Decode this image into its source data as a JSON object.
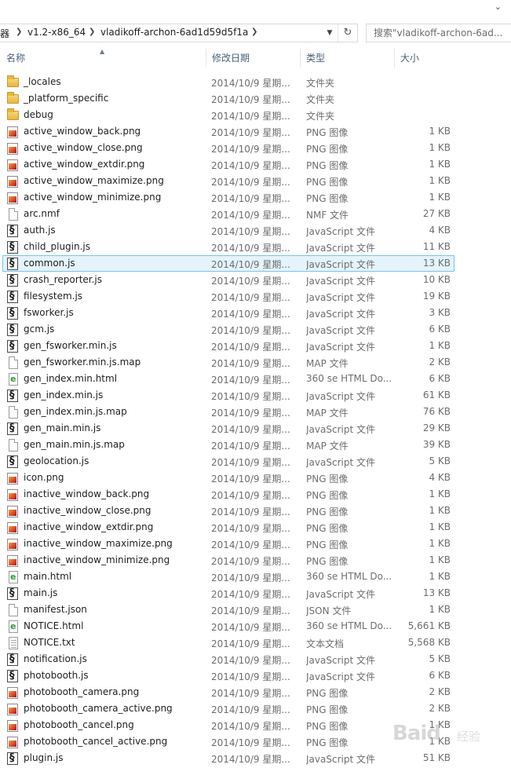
{
  "address_bar": {
    "crumbs": [
      "器",
      "v1.2-x86_64",
      "vladikoff-archon-6ad1d59d5f1a"
    ]
  },
  "search": {
    "placeholder": "搜索\"vladikoff-archon-6ad..."
  },
  "columns": {
    "name": "名称",
    "date": "修改日期",
    "type": "类型",
    "size": "大小"
  },
  "files": [
    {
      "name": "_locales",
      "date": "2014/10/9 星期...",
      "type": "文件夹",
      "size": "",
      "icon": "folder-icon"
    },
    {
      "name": "_platform_specific",
      "date": "2014/10/9 星期...",
      "type": "文件夹",
      "size": "",
      "icon": "folder-icon"
    },
    {
      "name": "debug",
      "date": "2014/10/9 星期...",
      "type": "文件夹",
      "size": "",
      "icon": "folder-icon"
    },
    {
      "name": "active_window_back.png",
      "date": "2014/10/9 星期...",
      "type": "PNG 图像",
      "size": "1 KB",
      "icon": "png-image-icon"
    },
    {
      "name": "active_window_close.png",
      "date": "2014/10/9 星期...",
      "type": "PNG 图像",
      "size": "1 KB",
      "icon": "png-image-icon"
    },
    {
      "name": "active_window_extdir.png",
      "date": "2014/10/9 星期...",
      "type": "PNG 图像",
      "size": "1 KB",
      "icon": "png-image-icon"
    },
    {
      "name": "active_window_maximize.png",
      "date": "2014/10/9 星期...",
      "type": "PNG 图像",
      "size": "1 KB",
      "icon": "png-image-icon"
    },
    {
      "name": "active_window_minimize.png",
      "date": "2014/10/9 星期...",
      "type": "PNG 图像",
      "size": "1 KB",
      "icon": "png-image-icon"
    },
    {
      "name": "arc.nmf",
      "date": "2014/10/9 星期...",
      "type": "NMF 文件",
      "size": "27 KB",
      "icon": "generic-file-icon"
    },
    {
      "name": "auth.js",
      "date": "2014/10/9 星期...",
      "type": "JavaScript 文件",
      "size": "4 KB",
      "icon": "javascript-file-icon"
    },
    {
      "name": "child_plugin.js",
      "date": "2014/10/9 星期...",
      "type": "JavaScript 文件",
      "size": "11 KB",
      "icon": "javascript-file-icon"
    },
    {
      "name": "common.js",
      "date": "2014/10/9 星期...",
      "type": "JavaScript 文件",
      "size": "13 KB",
      "icon": "javascript-file-icon",
      "selected": true
    },
    {
      "name": "crash_reporter.js",
      "date": "2014/10/9 星期...",
      "type": "JavaScript 文件",
      "size": "10 KB",
      "icon": "javascript-file-icon"
    },
    {
      "name": "filesystem.js",
      "date": "2014/10/9 星期...",
      "type": "JavaScript 文件",
      "size": "19 KB",
      "icon": "javascript-file-icon"
    },
    {
      "name": "fsworker.js",
      "date": "2014/10/9 星期...",
      "type": "JavaScript 文件",
      "size": "3 KB",
      "icon": "javascript-file-icon"
    },
    {
      "name": "gcm.js",
      "date": "2014/10/9 星期...",
      "type": "JavaScript 文件",
      "size": "6 KB",
      "icon": "javascript-file-icon"
    },
    {
      "name": "gen_fsworker.min.js",
      "date": "2014/10/9 星期...",
      "type": "JavaScript 文件",
      "size": "1 KB",
      "icon": "javascript-file-icon"
    },
    {
      "name": "gen_fsworker.min.js.map",
      "date": "2014/10/9 星期...",
      "type": "MAP 文件",
      "size": "2 KB",
      "icon": "generic-file-icon"
    },
    {
      "name": "gen_index.min.html",
      "date": "2014/10/9 星期...",
      "type": "360 se HTML Do...",
      "size": "6 KB",
      "icon": "html-file-icon"
    },
    {
      "name": "gen_index.min.js",
      "date": "2014/10/9 星期...",
      "type": "JavaScript 文件",
      "size": "61 KB",
      "icon": "javascript-file-icon"
    },
    {
      "name": "gen_index.min.js.map",
      "date": "2014/10/9 星期...",
      "type": "MAP 文件",
      "size": "76 KB",
      "icon": "generic-file-icon"
    },
    {
      "name": "gen_main.min.js",
      "date": "2014/10/9 星期...",
      "type": "JavaScript 文件",
      "size": "29 KB",
      "icon": "javascript-file-icon"
    },
    {
      "name": "gen_main.min.js.map",
      "date": "2014/10/9 星期...",
      "type": "MAP 文件",
      "size": "39 KB",
      "icon": "generic-file-icon"
    },
    {
      "name": "geolocation.js",
      "date": "2014/10/9 星期...",
      "type": "JavaScript 文件",
      "size": "5 KB",
      "icon": "javascript-file-icon"
    },
    {
      "name": "icon.png",
      "date": "2014/10/9 星期...",
      "type": "PNG 图像",
      "size": "4 KB",
      "icon": "png-image-icon"
    },
    {
      "name": "inactive_window_back.png",
      "date": "2014/10/9 星期...",
      "type": "PNG 图像",
      "size": "1 KB",
      "icon": "png-image-icon"
    },
    {
      "name": "inactive_window_close.png",
      "date": "2014/10/9 星期...",
      "type": "PNG 图像",
      "size": "1 KB",
      "icon": "png-image-icon"
    },
    {
      "name": "inactive_window_extdir.png",
      "date": "2014/10/9 星期...",
      "type": "PNG 图像",
      "size": "1 KB",
      "icon": "png-image-icon"
    },
    {
      "name": "inactive_window_maximize.png",
      "date": "2014/10/9 星期...",
      "type": "PNG 图像",
      "size": "1 KB",
      "icon": "png-image-icon"
    },
    {
      "name": "inactive_window_minimize.png",
      "date": "2014/10/9 星期...",
      "type": "PNG 图像",
      "size": "1 KB",
      "icon": "png-image-icon"
    },
    {
      "name": "main.html",
      "date": "2014/10/9 星期...",
      "type": "360 se HTML Do...",
      "size": "1 KB",
      "icon": "html-file-icon"
    },
    {
      "name": "main.js",
      "date": "2014/10/9 星期...",
      "type": "JavaScript 文件",
      "size": "13 KB",
      "icon": "javascript-file-icon"
    },
    {
      "name": "manifest.json",
      "date": "2014/10/9 星期...",
      "type": "JSON 文件",
      "size": "1 KB",
      "icon": "generic-file-icon"
    },
    {
      "name": "NOTICE.html",
      "date": "2014/10/9 星期...",
      "type": "360 se HTML Do...",
      "size": "5,661 KB",
      "icon": "html-file-icon"
    },
    {
      "name": "NOTICE.txt",
      "date": "2014/10/9 星期...",
      "type": "文本文档",
      "size": "5,568 KB",
      "icon": "text-file-icon"
    },
    {
      "name": "notification.js",
      "date": "2014/10/9 星期...",
      "type": "JavaScript 文件",
      "size": "5 KB",
      "icon": "javascript-file-icon"
    },
    {
      "name": "photobooth.js",
      "date": "2014/10/9 星期...",
      "type": "JavaScript 文件",
      "size": "6 KB",
      "icon": "javascript-file-icon"
    },
    {
      "name": "photobooth_camera.png",
      "date": "2014/10/9 星期...",
      "type": "PNG 图像",
      "size": "2 KB",
      "icon": "png-image-icon"
    },
    {
      "name": "photobooth_camera_active.png",
      "date": "2014/10/9 星期...",
      "type": "PNG 图像",
      "size": "2 KB",
      "icon": "png-image-icon"
    },
    {
      "name": "photobooth_cancel.png",
      "date": "2014/10/9 星期...",
      "type": "PNG 图像",
      "size": "1 KB",
      "icon": "png-image-icon"
    },
    {
      "name": "photobooth_cancel_active.png",
      "date": "2014/10/9 星期...",
      "type": "PNG 图像",
      "size": "1 KB",
      "icon": "png-image-icon"
    },
    {
      "name": "plugin.js",
      "date": "2014/10/9 星期...",
      "type": "JavaScript 文件",
      "size": "51 KB",
      "icon": "javascript-file-icon"
    }
  ],
  "watermark": {
    "text": "Baid",
    "sub": "经验"
  },
  "colors": {
    "header_text": "#4c607a",
    "selection_bg": "#e5f3fb",
    "selection_border": "#7ac3e8",
    "secondary_text": "#6d6d6d"
  }
}
